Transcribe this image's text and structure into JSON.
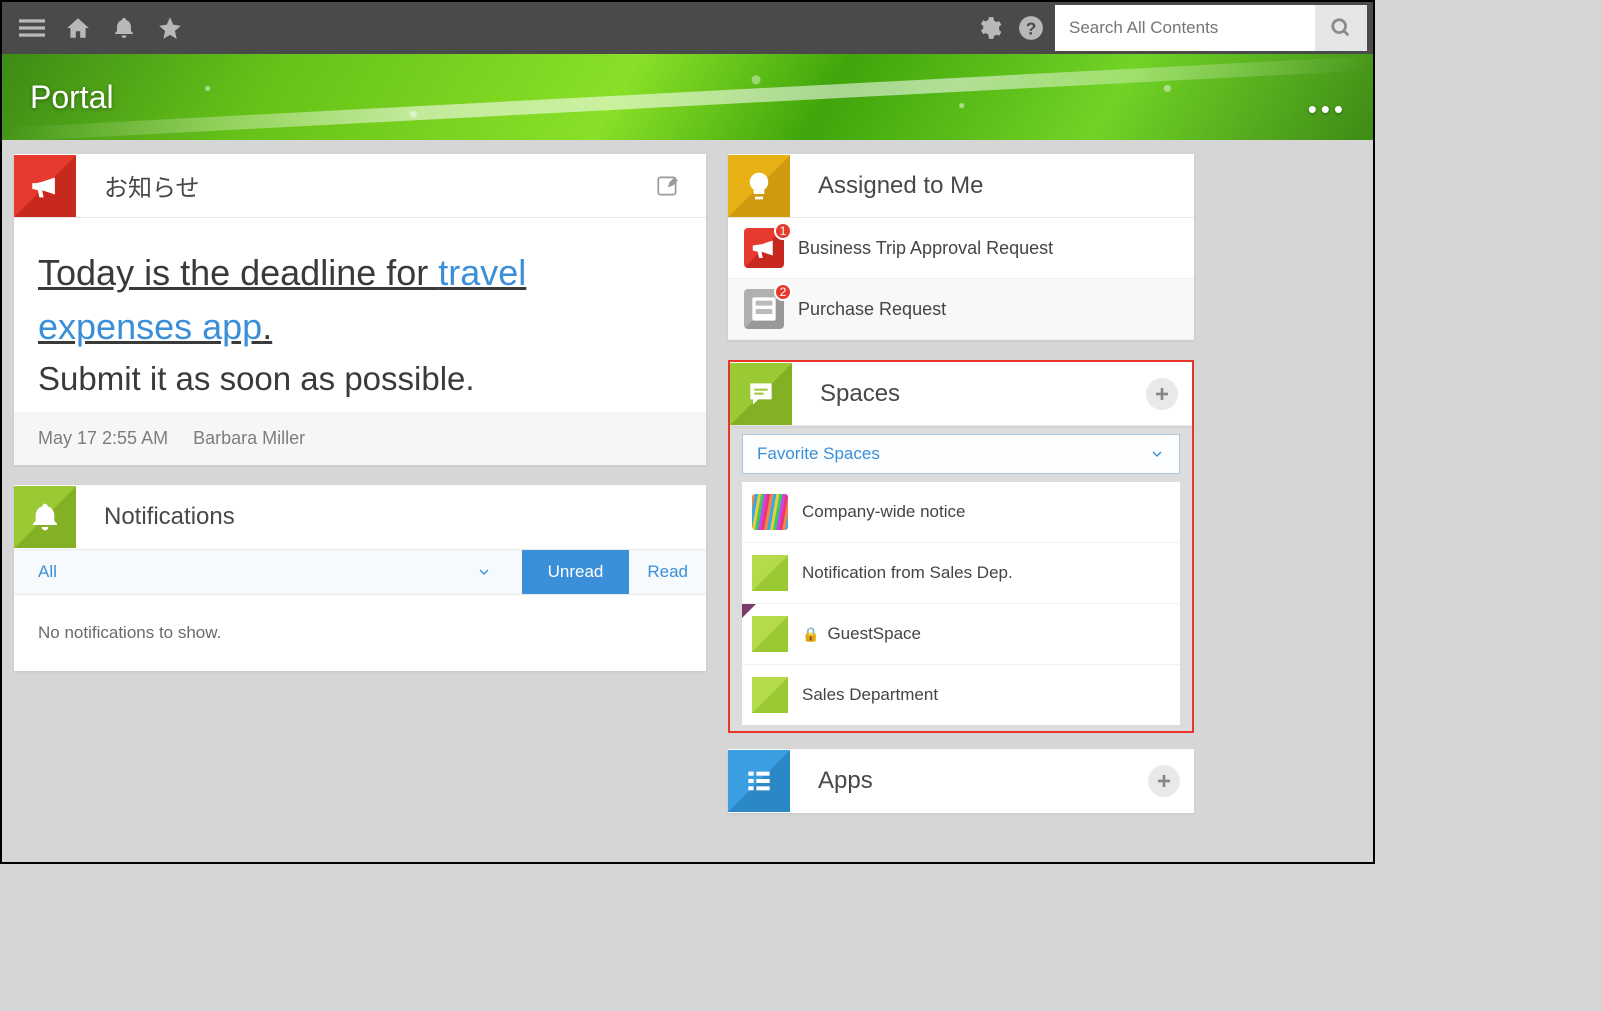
{
  "search": {
    "placeholder": "Search All Contents"
  },
  "banner": {
    "title": "Portal"
  },
  "announcements": {
    "title": "お知らせ",
    "headline_prefix": "Today is the deadline for ",
    "headline_link": "travel expenses app",
    "headline_suffix": ".",
    "body": "Submit it as soon as possible.",
    "meta_time": "May 17 2:55 AM",
    "meta_author": "Barbara Miller"
  },
  "notifications": {
    "title": "Notifications",
    "filter_label": "All",
    "tab_unread": "Unread",
    "tab_read": "Read",
    "empty": "No notifications to show."
  },
  "assigned": {
    "title": "Assigned to Me",
    "items": [
      {
        "label": "Business Trip Approval Request",
        "badge": "1",
        "tile": "red"
      },
      {
        "label": "Purchase Request",
        "badge": "2",
        "tile": "gray"
      }
    ]
  },
  "spaces": {
    "title": "Spaces",
    "selector": "Favorite Spaces",
    "items": [
      {
        "label": "Company-wide notice",
        "icon": "pencils"
      },
      {
        "label": "Notification from Sales Dep.",
        "icon": "green"
      },
      {
        "label": "GuestSpace",
        "icon": "green",
        "locked": true,
        "corner": true
      },
      {
        "label": "Sales Department",
        "icon": "green"
      }
    ]
  },
  "apps": {
    "title": "Apps"
  }
}
